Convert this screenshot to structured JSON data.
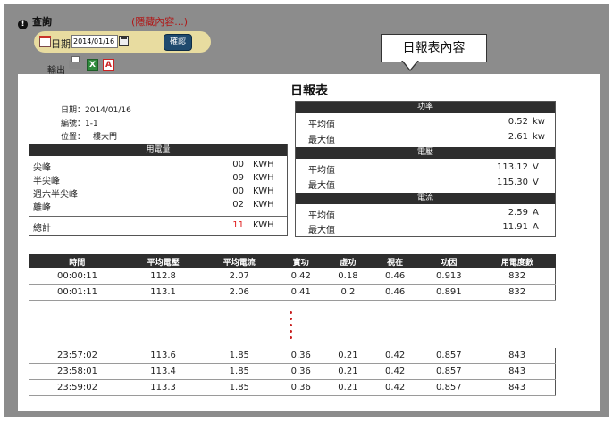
{
  "query": {
    "title": "查詢",
    "hidden_hint": "(隱藏內容...)"
  },
  "filter": {
    "date_label": "日期",
    "date_value": "2014/01/16",
    "confirm_label": "確認"
  },
  "export": {
    "label": "輸出"
  },
  "callout": {
    "text": "日報表內容"
  },
  "report": {
    "title": "日報表",
    "meta": {
      "date": "日期：2014/01/16",
      "id": "編號：1-1",
      "location": "位置：一樓大門"
    },
    "usage": {
      "header": "用電量",
      "rows": [
        {
          "name": "尖峰",
          "value": "00",
          "unit": "KWH"
        },
        {
          "name": "半尖峰",
          "value": "09",
          "unit": "KWH"
        },
        {
          "name": "週六半尖峰",
          "value": "00",
          "unit": "KWH"
        },
        {
          "name": "離峰",
          "value": "02",
          "unit": "KWH"
        }
      ],
      "total": {
        "name": "總計",
        "value": "11",
        "unit": "KWH"
      },
      "total_color": "#e02020"
    },
    "power": {
      "header": "功率",
      "avg_label": "平均值",
      "avg": "0.52",
      "max_label": "最大值",
      "max": "2.61",
      "unit": "kw"
    },
    "voltage": {
      "header": "電壓",
      "avg_label": "平均值",
      "avg": "113.12",
      "max_label": "最大值",
      "max": "115.30",
      "unit": "V"
    },
    "current": {
      "header": "電流",
      "avg_label": "平均值",
      "avg": "2.59",
      "max_label": "最大值",
      "max": "11.91",
      "unit": "A"
    },
    "table": {
      "headers": [
        "時間",
        "平均電壓",
        "平均電流",
        "實功",
        "虛功",
        "視在",
        "功因",
        "用電度數"
      ],
      "rows_top": [
        [
          "00:00:11",
          "112.8",
          "2.07",
          "0.42",
          "0.18",
          "0.46",
          "0.913",
          "832"
        ],
        [
          "00:01:11",
          "113.1",
          "2.06",
          "0.41",
          "0.2",
          "0.46",
          "0.891",
          "832"
        ]
      ],
      "rows_bottom": [
        [
          "23:57:02",
          "113.6",
          "1.85",
          "0.36",
          "0.21",
          "0.42",
          "0.857",
          "843"
        ],
        [
          "23:58:01",
          "113.4",
          "1.85",
          "0.36",
          "0.21",
          "0.42",
          "0.857",
          "843"
        ],
        [
          "23:59:02",
          "113.3",
          "1.85",
          "0.36",
          "0.21",
          "0.42",
          "0.857",
          "843"
        ]
      ]
    }
  }
}
